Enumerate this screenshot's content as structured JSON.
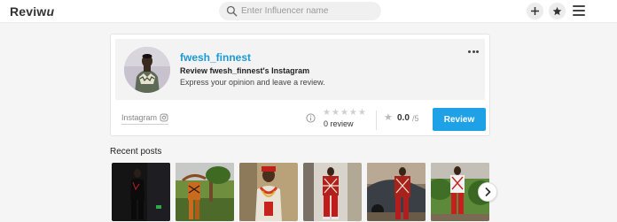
{
  "header": {
    "logo_main": "Reviw",
    "logo_italic": "u",
    "search_placeholder": "Enter Influencer name",
    "icons": [
      "plus-icon",
      "star-icon",
      "hamburger-menu-icon"
    ]
  },
  "profile": {
    "name": "fwesh_finnest",
    "subtitle": "Review fwesh_finnest's Instagram",
    "description": "Express your opinion and leave a review.",
    "platform_label": "Instagram",
    "review_count_label": "0 review",
    "star_rating": 0,
    "star_max": 5,
    "score": "0.0",
    "score_max": "/5",
    "review_button_label": "Review"
  },
  "recent_posts": {
    "title": "Recent posts",
    "count": 6
  },
  "colors": {
    "accent": "#1ea1e6",
    "name_link": "#1a9ad6",
    "background": "#f5f5f5"
  }
}
